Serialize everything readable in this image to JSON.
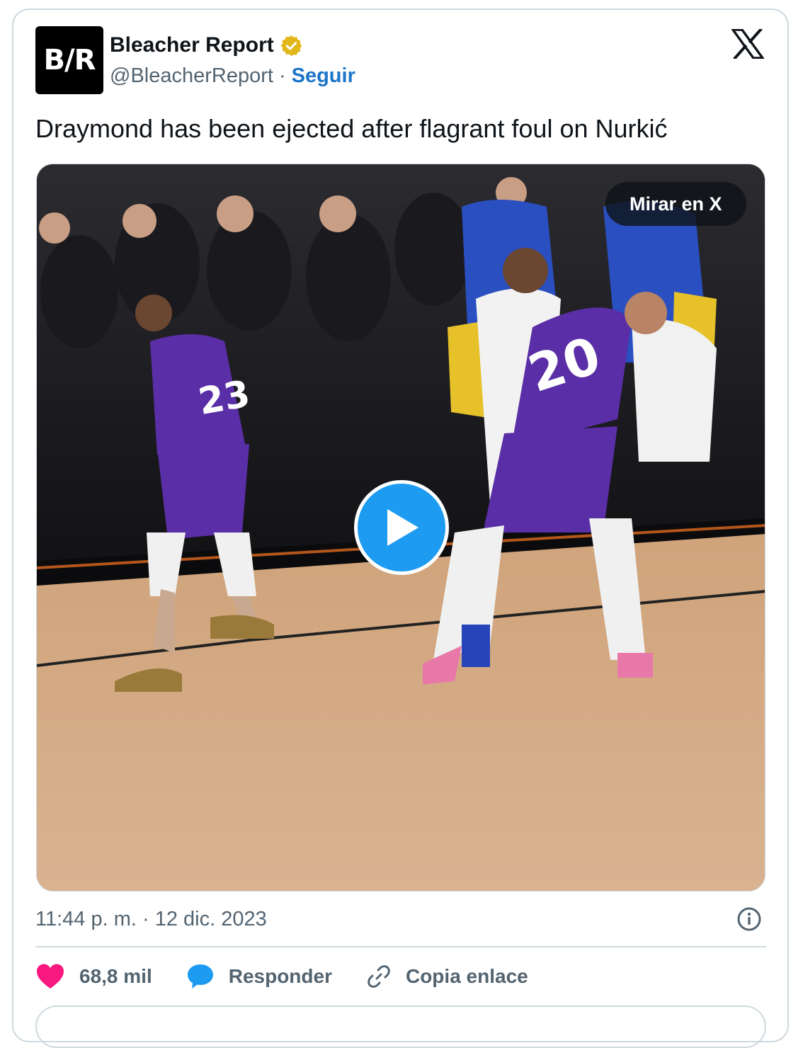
{
  "author": {
    "avatar_text": "B/R",
    "name": "Bleacher Report",
    "handle": "@BleacherReport",
    "separator": "·",
    "follow_label": "Seguir"
  },
  "tweet": {
    "text": "Draymond has been ejected after flagrant foul on Nurkić"
  },
  "media": {
    "watch_label": "Mirar en X",
    "jersey_left": "23",
    "jersey_right": "20"
  },
  "meta": {
    "timestamp": "11:44 p. m. · 12 dic. 2023"
  },
  "actions": {
    "likes": "68,8 mil",
    "reply_label": "Responder",
    "copy_label": "Copia enlace"
  },
  "colors": {
    "follow": "#1d75c9",
    "like": "#f91880",
    "reply": "#1d9bf0",
    "play": "#1d9bf0",
    "verified": "#e2b719"
  },
  "icons": [
    "verified-badge-icon",
    "x-logo-icon",
    "play-icon",
    "info-icon",
    "heart-icon",
    "reply-bubble-icon",
    "link-icon"
  ]
}
